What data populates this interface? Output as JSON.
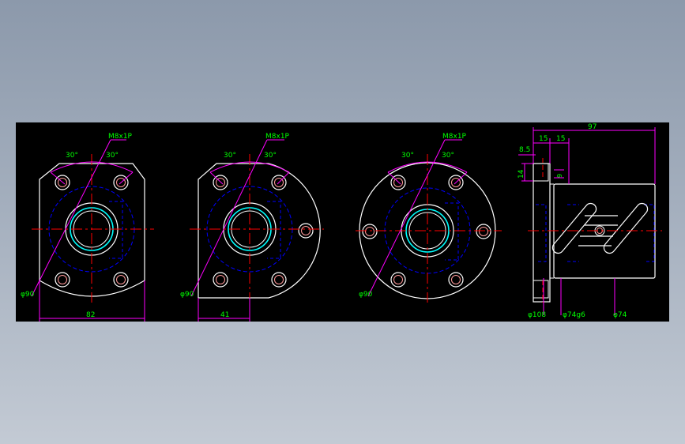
{
  "drawing": {
    "background": "#000000",
    "colors": {
      "outline": "#ffffff",
      "dimension": "#ff00ff",
      "centerline": "#ff0000",
      "hidden": "#0000ff",
      "text": "#00ff00",
      "thread": "#00ffff",
      "hatch": "#ffff00"
    }
  },
  "views": {
    "view1": {
      "thread_callout": "M8x1P",
      "angle_left": "30°",
      "angle_right": "30°",
      "diameter": "φ90",
      "width": "82"
    },
    "view2": {
      "thread_callout": "M8x1P",
      "angle_left": "30°",
      "angle_right": "30°",
      "diameter": "φ90",
      "offset": "41"
    },
    "view3": {
      "thread_callout": "M8x1P",
      "angle_left": "30°",
      "angle_right": "30°",
      "diameter": "φ90"
    },
    "side": {
      "overall_length": "97",
      "flange_a": "15",
      "flange_b": "15",
      "step": "8.5",
      "height": "14",
      "hole": "9",
      "dia_flange": "φ108",
      "dia_body": "φ74g6",
      "dia_body_tol": "φ74"
    }
  }
}
